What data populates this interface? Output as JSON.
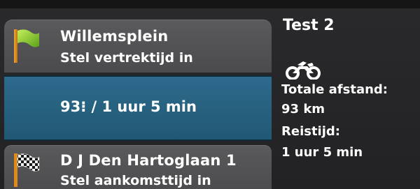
{
  "route": {
    "start": {
      "title": "Willemsplein",
      "action": "Stel vertrektijd in",
      "icon": "green-flag-icon"
    },
    "leg": {
      "summary": "93 km / 1 uur 5 min",
      "shown_text": "93⁝ / 1 uur 5 min"
    },
    "end": {
      "title": "D J Den Hartoglaan 1",
      "action": "Stel aankomsttijd in",
      "icon": "checkered-flag-icon"
    }
  },
  "info": {
    "title": "Test 2",
    "vehicle_icon": "motorcycle-icon",
    "distance_label": "Totale afstand:",
    "distance_value": "93 km",
    "time_label": "Reistijd:",
    "time_value": "1 uur 5 min"
  },
  "colors": {
    "background": "#222224",
    "card": "#515153",
    "leg_bar": "#2a6585",
    "flag_green": "#8ccf2a",
    "pole_orange": "#e08a1a"
  }
}
